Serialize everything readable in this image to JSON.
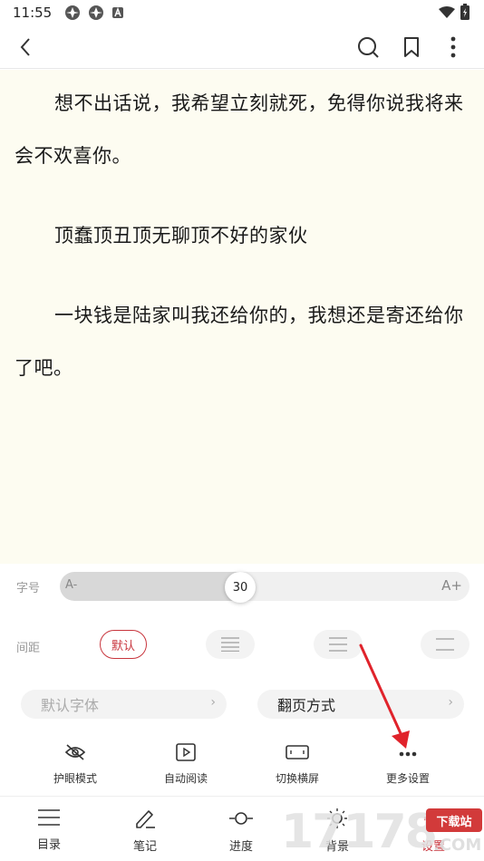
{
  "status": {
    "time": "11:55"
  },
  "reader": {
    "paragraphs": [
      "想不出话说，我希望立刻就死，免得你说我将来会不欢喜你。",
      "顶蠢顶丑顶无聊顶不好的家伙",
      "一块钱是陆家叫我还给你的，我想还是寄还给你了吧。"
    ],
    "background": "#fdfcf1"
  },
  "settings": {
    "font_size_label": "字号",
    "font_size_value": "30",
    "font_size_fraction": 0.44,
    "slider_small": "A-",
    "slider_large": "A+",
    "spacing_label": "间距",
    "spacing_default": "默认",
    "font_pill": "默认字体",
    "page_turn_pill": "翻页方式",
    "accent": "#c8353d"
  },
  "tools": [
    {
      "label": "护眼模式",
      "icon": "eye-off-icon"
    },
    {
      "label": "自动阅读",
      "icon": "play-icon"
    },
    {
      "label": "切换横屏",
      "icon": "landscape-icon"
    },
    {
      "label": "更多设置",
      "icon": "more-icon"
    }
  ],
  "nav": [
    {
      "label": "目录",
      "icon": "list-icon"
    },
    {
      "label": "笔记",
      "icon": "edit-icon"
    },
    {
      "label": "进度",
      "icon": "progress-icon"
    },
    {
      "label": "背景",
      "icon": "brightness-icon"
    },
    {
      "label": "设置",
      "icon": "settings-icon"
    }
  ],
  "watermark": {
    "numbers": "17178",
    "badge": "下载站",
    "suffix": ".COM"
  }
}
